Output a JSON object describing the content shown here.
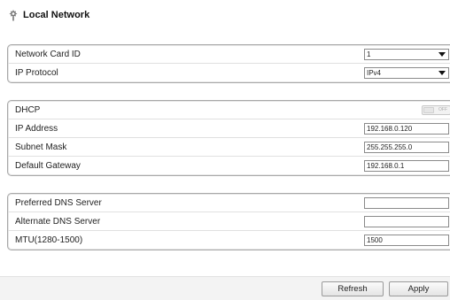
{
  "page": {
    "title": "Local Network",
    "title_icon": "settings-icon"
  },
  "groups": {
    "card": {
      "rows": [
        {
          "label": "Network Card ID",
          "value": "1"
        },
        {
          "label": "IP Protocol",
          "value": "IPv4"
        }
      ]
    },
    "ip": {
      "dhcp_label": "DHCP",
      "dhcp_state": "OFF",
      "rows": [
        {
          "label": "IP Address",
          "value": "192.168.0.120"
        },
        {
          "label": "Subnet Mask",
          "value": "255.255.255.0"
        },
        {
          "label": "Default Gateway",
          "value": "192.168.0.1"
        }
      ]
    },
    "dns": {
      "rows": [
        {
          "label": "Preferred DNS Server",
          "value": ""
        },
        {
          "label": "Alternate DNS Server",
          "value": ""
        },
        {
          "label": "MTU(1280-1500)",
          "value": "1500"
        }
      ]
    }
  },
  "buttons": {
    "refresh": "Refresh",
    "apply": "Apply"
  },
  "colors": {
    "border": "#a8a8a8",
    "field_border": "#8a8a8a",
    "footer_bg": "#f3f3f3"
  }
}
